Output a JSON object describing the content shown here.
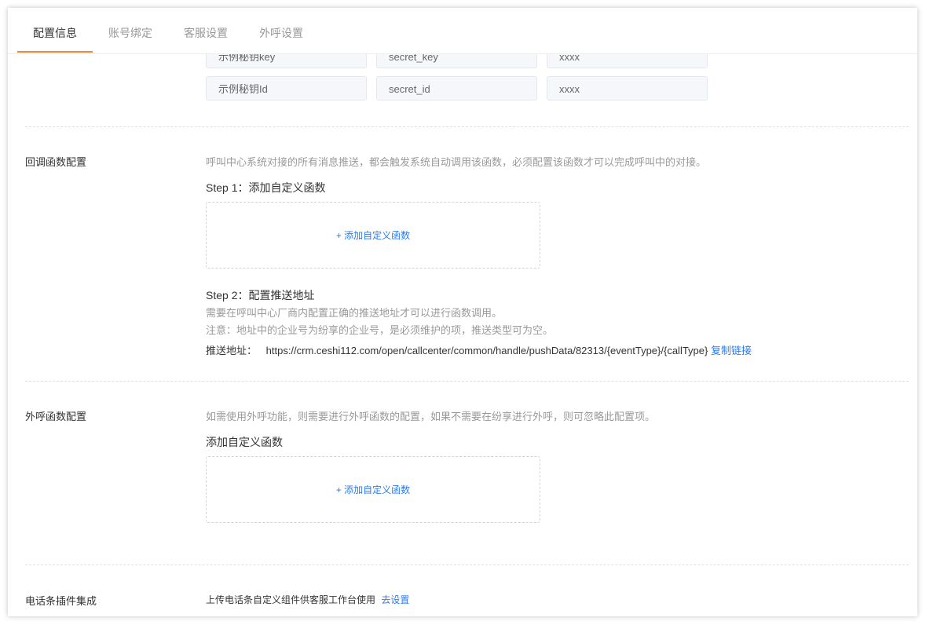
{
  "tabs": [
    {
      "label": "配置信息",
      "active": true
    },
    {
      "label": "账号绑定",
      "active": false
    },
    {
      "label": "客服设置",
      "active": false
    },
    {
      "label": "外呼设置",
      "active": false
    }
  ],
  "secret_rows": [
    {
      "label": "示例秘钥key",
      "name": "secret_key",
      "value": "xxxx"
    },
    {
      "label": "示例秘钥Id",
      "name": "secret_id",
      "value": "xxxx"
    }
  ],
  "callback": {
    "title": "回调函数配置",
    "desc": "呼叫中心系统对接的所有消息推送，都会触发系统自动调用该函数，必须配置该函数才可以完成呼叫中的对接。",
    "step1": "Step 1：添加自定义函数",
    "add_label": "+ 添加自定义函数",
    "step2": "Step 2：配置推送地址",
    "note1": "需要在呼叫中心厂商内配置正确的推送地址才可以进行函数调用。",
    "note2": "注意：地址中的企业号为纷享的企业号，是必须维护的项，推送类型可为空。",
    "push_label": "推送地址：",
    "push_url": "https://crm.ceshi112.com/open/callcenter/common/handle/pushData/82313/{eventType}/{callType}",
    "copy_label": "复制链接"
  },
  "outbound": {
    "title": "外呼函数配置",
    "desc": "如需使用外呼功能，则需要进行外呼函数的配置，如果不需要在纷享进行外呼，则可忽略此配置项。",
    "step": "添加自定义函数",
    "add_label": "+ 添加自定义函数"
  },
  "plugin": {
    "title": "电话条插件集成",
    "text": "上传电话条自定义组件供客服工作台使用",
    "link": "去设置"
  },
  "colors": {
    "accent": "#f0883a",
    "link": "#2b7cf0"
  }
}
